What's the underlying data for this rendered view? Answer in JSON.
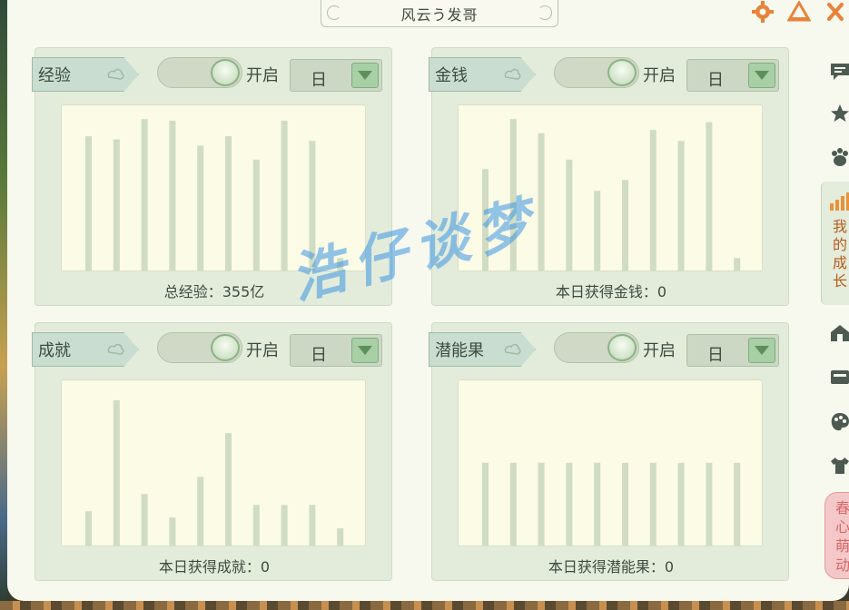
{
  "window": {
    "title": "风云う发哥"
  },
  "colors": {
    "bar": "#d0dcc3",
    "accent_green": "#a8cfa5",
    "tab_text_orange": "#b35d1f",
    "promo_pink": "#f4c8c8"
  },
  "panels": [
    {
      "label": "经验",
      "toggle_label": "开启",
      "toggle_on": true,
      "period": "日",
      "summary": "总经验：355亿",
      "bars": [
        0.86,
        0.84,
        0.97,
        0.96,
        0.8,
        0.86,
        0.71,
        0.96,
        0.83,
        0.08
      ]
    },
    {
      "label": "金钱",
      "toggle_label": "开启",
      "toggle_on": true,
      "period": "日",
      "summary": "本日获得金钱：0",
      "bars": [
        0.65,
        0.97,
        0.88,
        0.71,
        0.51,
        0.58,
        0.9,
        0.83,
        0.95,
        0.08
      ]
    },
    {
      "label": "成就",
      "toggle_label": "开启",
      "toggle_on": true,
      "period": "日",
      "summary": "本日获得成就：0",
      "bars": [
        0.22,
        0.93,
        0.33,
        0.18,
        0.44,
        0.72,
        0.26,
        0.26,
        0.26,
        0.11
      ]
    },
    {
      "label": "潜能果",
      "toggle_label": "开启",
      "toggle_on": true,
      "period": "日",
      "summary": "本日获得潜能果：0",
      "bars": [
        0.53,
        0.53,
        0.53,
        0.53,
        0.53,
        0.53,
        0.53,
        0.53,
        0.53,
        0.53
      ]
    }
  ],
  "sidebar": {
    "active_tab_label": "我的成长",
    "promo_label": "春心萌动",
    "icons": [
      "chat-bubble-icon",
      "star-icon",
      "paw-icon",
      "bar-chart-icon",
      "house-icon",
      "wallet-icon",
      "palette-icon",
      "shirt-icon"
    ]
  },
  "top_icons": [
    "gear-icon",
    "warning-icon",
    "close-icon"
  ],
  "watermark": "浩仔谈梦"
}
